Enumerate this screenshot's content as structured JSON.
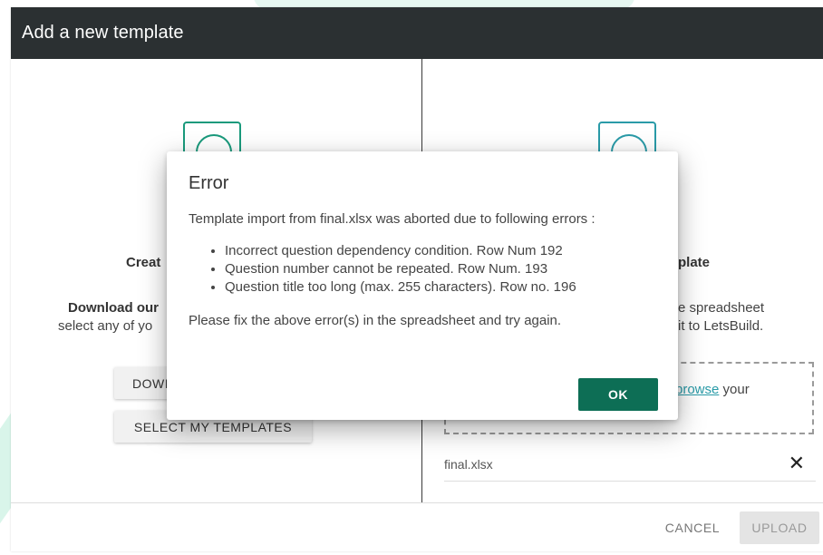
{
  "modal": {
    "title": "Add a new template"
  },
  "left_panel": {
    "title_visible": "Creat",
    "desc_bold_visible": "Download our",
    "desc_visible": "select any of yo",
    "download_button_visible": "DOWI",
    "select_button": "SELECT MY TEMPLATES"
  },
  "right_panel": {
    "title_visible": "plate",
    "desc_line1_visible": "e spreadsheet",
    "desc_line2_visible": "it to LetsBuild.",
    "drop_link": "browse",
    "drop_suffix": " your",
    "file_name": "final.xlsx",
    "remove_icon": "close-icon"
  },
  "footer": {
    "cancel_label": "CANCEL",
    "upload_label": "UPLOAD"
  },
  "error_dialog": {
    "title": "Error",
    "intro": "Template import from final.xlsx was aborted due to following errors :",
    "errors": [
      "Incorrect question dependency condition. Row Num 192",
      "Question number cannot be repeated. Row Num. 193",
      "Question title too long (max. 255 characters). Row no. 196"
    ],
    "fix_text": "Please fix the above error(s) in the spreadsheet and try again.",
    "ok_label": "OK"
  },
  "colors": {
    "header_bg": "#2b3032",
    "accent": "#0d6e55",
    "icon_green": "#1a9a7c",
    "icon_teal": "#2a9ba8"
  }
}
